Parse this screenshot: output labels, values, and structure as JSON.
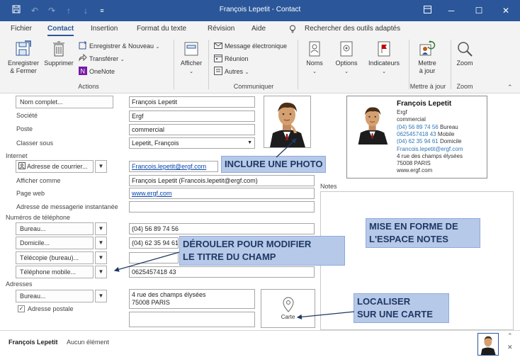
{
  "window": {
    "title": "François Lepetit - Contact",
    "quick_access": {
      "save": "save-icon",
      "undo": "undo-icon",
      "redo": "redo-icon",
      "up": "arrow-up-icon",
      "down": "arrow-down-icon",
      "customize": "customize-icon"
    },
    "controls": {
      "restore": "ribbon-display-icon",
      "minimize": "minimize-icon",
      "maximize": "maximize-icon",
      "close": "close-icon"
    },
    "brand_color": "#2b579a"
  },
  "tabs": [
    "Fichier",
    "Contact",
    "Insertion",
    "Format du texte",
    "Révision",
    "Aide"
  ],
  "active_tab": "Contact",
  "tell_me": "Rechercher des outils adaptés",
  "ribbon": {
    "actions": {
      "save_close": "Enregistrer\n& Fermer",
      "delete": "Supprimer",
      "save_new": "Enregistrer & Nouveau",
      "forward": "Transférer",
      "onenote": "OneNote",
      "label": "Actions"
    },
    "show": {
      "label": "Afficher"
    },
    "communicate": {
      "email": "Message électronique",
      "meeting": "Réunion",
      "more": "Autres",
      "label": "Communiquer"
    },
    "names": "Noms",
    "options": "Options",
    "tags": "Indicateurs",
    "update": {
      "btn": "Mettre\nà jour",
      "label": "Mettre à jour"
    },
    "zoom": {
      "btn": "Zoom",
      "label": "Zoom"
    }
  },
  "form": {
    "full_name_btn": "Nom complet...",
    "full_name": "François Lepetit",
    "company_label": "Société",
    "company": "Ergf",
    "job_label": "Poste",
    "job": "commercial",
    "file_as_label": "Classer sous",
    "file_as": "Lepetit, François",
    "internet_label": "Internet",
    "email_btn": "Adresse de courrier...",
    "email": "Francois.lepetit@ergf.com",
    "display_as_label": "Afficher comme",
    "display_as": "François Lepetit (Francois.lepetit@ergf.com)",
    "web_label": "Page web",
    "web": "www.ergf.com",
    "im_label": "Adresse de messagerie instantanée",
    "im": "",
    "phones_label": "Numéros de téléphone",
    "phones": [
      {
        "type": "Bureau...",
        "value": "(04) 56 89 74 56"
      },
      {
        "type": "Domicile...",
        "value": "(04) 62 35 94 61"
      },
      {
        "type": "Télécopie (bureau)...",
        "value": ""
      },
      {
        "type": "Téléphone mobile...",
        "value": "0625457418 43"
      }
    ],
    "addresses_label": "Adresses",
    "address_type": "Bureau...",
    "address": "4 rue des champs élysées\n75008 PARIS",
    "postal_label": "Adresse postale",
    "postal_checked": true,
    "map_label": "Carte",
    "notes_label": "Notes"
  },
  "card": {
    "name": "François Lepetit",
    "company": "Ergf",
    "job": "commercial",
    "phone_work": "(04) 56 89 74 56",
    "phone_work_type": "Bureau",
    "phone_mobile": "0625457418 43",
    "phone_mobile_type": "Mobile",
    "phone_home": "(04) 62 35 94 61",
    "phone_home_type": "Domicile",
    "email": "Francois.lepetit@ergf.com",
    "street": "4 rue des champs élysées",
    "city": "75008 PARIS",
    "web": "www.ergf.com"
  },
  "callouts": {
    "photo": "INCLURE UNE PHOTO",
    "notes": "MISE EN FORME DE\nL'ESPACE NOTES",
    "field": "DÉROULER POUR MODIFIER\nLE TITRE DU CHAMP",
    "map": "LOCALISER\nSUR UNE CARTE"
  },
  "status": {
    "name": "François Lepetit",
    "items": "Aucun élément"
  }
}
